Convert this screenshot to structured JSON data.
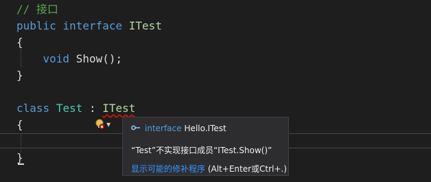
{
  "code": {
    "comment": "// 接口",
    "kw_public": "public",
    "kw_interface": "interface",
    "iface_name": "ITest",
    "brace_open": "{",
    "brace_close": "}",
    "kw_void": "void",
    "method_rest": " Show();",
    "kw_class": "class",
    "class_name": "Test",
    "colon": " : ",
    "base_name": "ITest"
  },
  "quick_info": {
    "icon": "interface-icon",
    "kind": "interface",
    "symbol": "Hello.ITest",
    "error_message": "“Test”不实现接口成员“ITest.Show()”",
    "fix_link": "显示可能的修补程序",
    "shortcut_hint": " (Alt+Enter或Ctrl+.)"
  },
  "lightbulb": {
    "icon": "lightbulb-error-icon",
    "caret_icon": "dropdown-caret-icon"
  },
  "colors": {
    "background": "#1e1e1e",
    "keyword": "#569cd6",
    "comment": "#57a64a",
    "type": "#4ec9b0",
    "interface": "#b8d7a3",
    "error_squiggle": "#e51400",
    "link": "#3794ff"
  }
}
